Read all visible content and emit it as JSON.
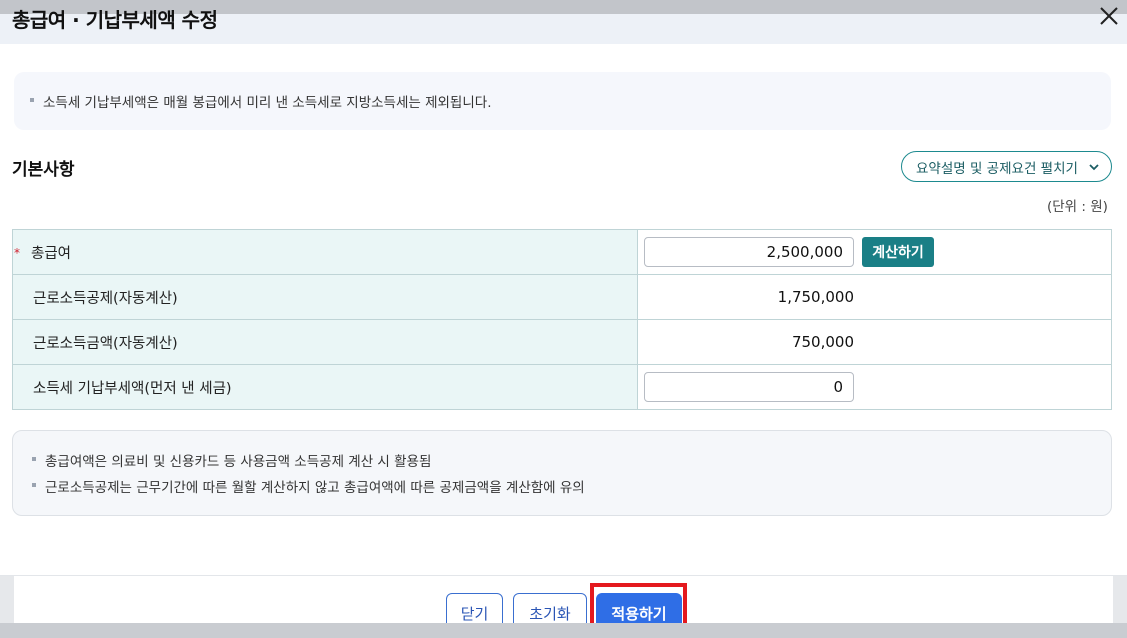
{
  "modal": {
    "title": "총급여 · 기납부세액 수정"
  },
  "notice": {
    "text": "소득세 기납부세액은 매월 봉급에서 미리 낸 소득세로 지방소득세는 제외됩니다."
  },
  "section": {
    "title": "기본사항",
    "expand_label": "요약설명 및 공제요건 펼치기",
    "unit": "(단위 : 원)"
  },
  "form": {
    "rows": [
      {
        "label": "총급여",
        "required_mark": "*",
        "value": "2,500,000",
        "editable": true,
        "action_label": "계산하기"
      },
      {
        "label": "근로소득공제(자동계산)",
        "value": "1,750,000",
        "editable": false
      },
      {
        "label": "근로소득금액(자동계산)",
        "value": "750,000",
        "editable": false
      },
      {
        "label": "소득세 기납부세액(먼저 낸 세금)",
        "value": "0",
        "editable": true
      }
    ]
  },
  "info": {
    "lines": [
      "총급여액은 의료비 및 신용카드 등 사용금액 소득공제 계산 시 활용됨",
      "근로소득공제는 근무기간에 따른 월할 계산하지 않고 총급여액에 따른 공제금액을 계산함에 유의"
    ]
  },
  "footer": {
    "close_label": "닫기",
    "reset_label": "초기화",
    "apply_label": "적용하기"
  },
  "colors": {
    "accent_teal": "#1a7f86",
    "primary_blue": "#2f6ee6",
    "highlight_red": "#e4191e",
    "label_bg": "#eaf6f6"
  },
  "icons": {
    "close": "close-icon",
    "chevron": "chevron-down-icon"
  }
}
